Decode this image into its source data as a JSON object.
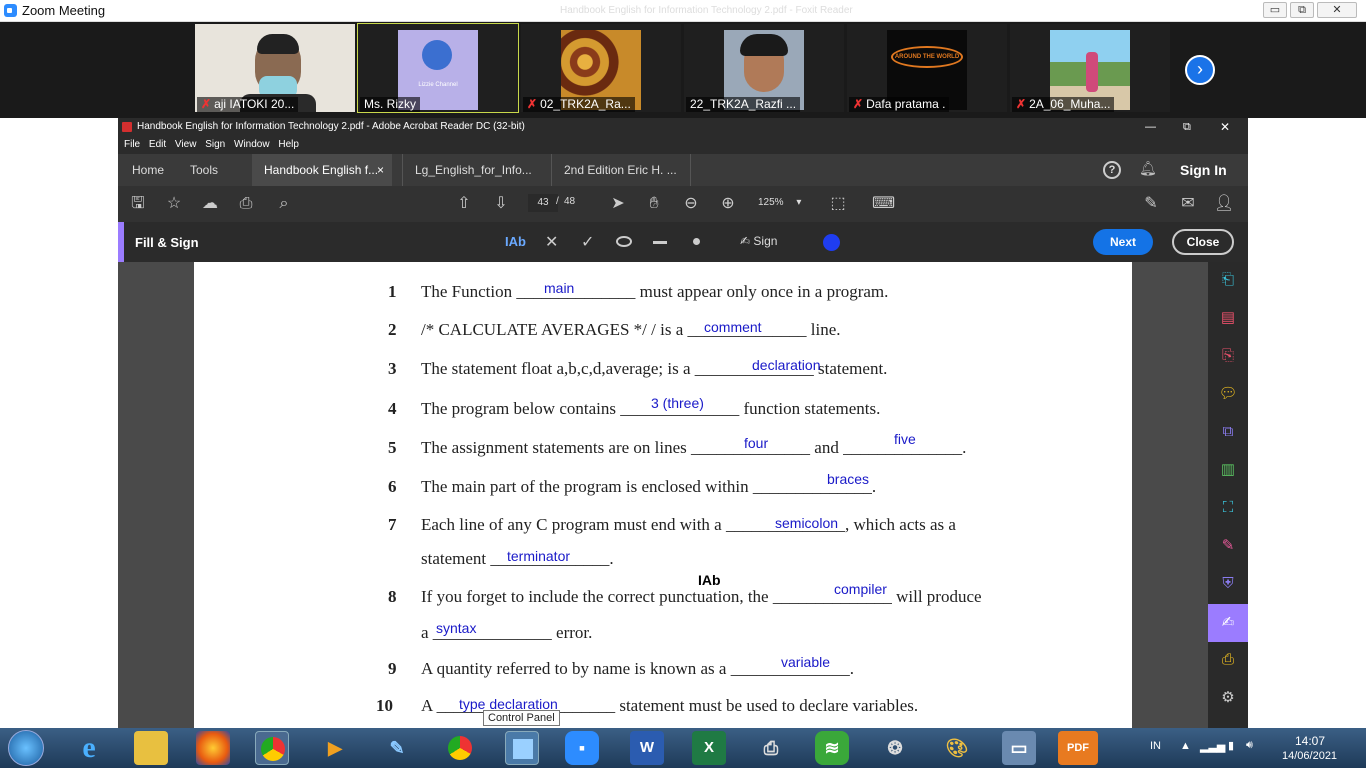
{
  "zoom": {
    "title": "Zoom Meeting",
    "faded_title": "Handbook English for Information Technology 2.pdf - Foxit Reader",
    "win_min": "▭",
    "win_restore": "⧉",
    "win_close": "✕",
    "participants": [
      {
        "name": "aji IATOKI 20...",
        "muted": true
      },
      {
        "name": "Ms. Rizky",
        "muted": false,
        "caption": "Lizzie Channel"
      },
      {
        "name": "02_TRK2A_Ra...",
        "muted": true
      },
      {
        "name": "22_TRK2A_Razfi ...",
        "muted": false
      },
      {
        "name": "Dafa pratama .",
        "muted": true,
        "caption": "AROUND THE WORLD"
      },
      {
        "name": "2A_06_Muha...",
        "muted": true
      }
    ],
    "next_arrow": "›"
  },
  "acrobat": {
    "title": "Handbook English for Information Technology 2.pdf - Adobe Acrobat Reader DC (32-bit)",
    "menu": [
      "File",
      "Edit",
      "View",
      "Sign",
      "Window",
      "Help"
    ],
    "home": "Home",
    "tools": "Tools",
    "tabs": [
      {
        "label": "Handbook English f...",
        "close": "×"
      },
      {
        "label": "Lg_English_for_Info..."
      },
      {
        "label": "2nd Edition Eric H. ..."
      }
    ],
    "help": "?",
    "signin": "Sign In",
    "page_current": "43",
    "page_sep": "/",
    "page_total": "48",
    "zoom_level": "125%",
    "fill_sign": {
      "label": "Fill & Sign",
      "text_tool": "IAb",
      "sign": "Sign",
      "next": "Next",
      "close": "Close"
    },
    "win_min": "—",
    "win_restore": "⧉",
    "win_close": "✕"
  },
  "worksheet": {
    "questions": [
      {
        "n": "1",
        "parts": [
          "The Function ",
          "______________",
          " must appear only once in a program."
        ],
        "answers": [
          "main"
        ]
      },
      {
        "n": "2",
        "parts": [
          "/* CALCULATE AVERAGES */ / is a ",
          "______________",
          " line."
        ],
        "answers": [
          "comment"
        ]
      },
      {
        "n": "3",
        "parts": [
          "The statement float a,b,c,d,average; is a ",
          "______________",
          " statement."
        ],
        "answers": [
          "declaration"
        ]
      },
      {
        "n": "4",
        "parts": [
          "The program below contains ",
          "______________",
          " function statements."
        ],
        "answers": [
          "3 (three)"
        ]
      },
      {
        "n": "5",
        "parts": [
          "The assignment statements are on lines ",
          "______________",
          " and ",
          "______________",
          "."
        ],
        "answers": [
          "four",
          "five"
        ]
      },
      {
        "n": "6",
        "parts": [
          "The main part of the program is enclosed within ",
          "______________",
          "."
        ],
        "answers": [
          "braces"
        ]
      },
      {
        "n": "7",
        "parts": [
          "Each line of any C program must end with a ",
          "______________",
          ", which acts as a"
        ],
        "cont": [
          "statement ",
          "______________",
          "."
        ],
        "answers": [
          "semicolon",
          "terminator"
        ]
      },
      {
        "n": "8",
        "parts": [
          "If you forget to include the correct punctuation, the ",
          "______________",
          " will produce"
        ],
        "cont": [
          "a ",
          "______________",
          " error."
        ],
        "answers": [
          "compiler",
          "syntax"
        ]
      },
      {
        "n": "9",
        "parts": [
          "A quantity referred to by name is known as a ",
          "______________",
          "."
        ],
        "answers": [
          "variable"
        ]
      },
      {
        "n": "10",
        "parts": [
          "A ",
          "_____________________",
          " statement must be used to declare variables."
        ],
        "answers": [
          "type declaration"
        ]
      }
    ],
    "cursor": "IAb",
    "tooltip": "Control Panel"
  },
  "taskbar": {
    "lang": "IN",
    "time": "14:07",
    "date": "14/06/2021",
    "apps": [
      "e",
      "W",
      "X",
      "PDF"
    ]
  },
  "colors": {
    "accent": "#1473e6",
    "answer": "#1a1ac8",
    "fill_sign_bar": "#9b7cff"
  }
}
